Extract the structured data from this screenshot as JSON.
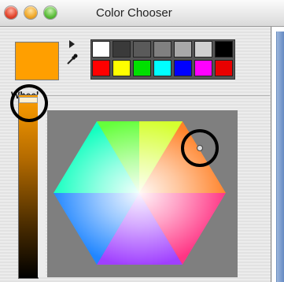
{
  "window": {
    "title": "Color Chooser"
  },
  "current_color": "#ff9f00",
  "palette": {
    "top_row": [
      "#ffffff",
      "#3a3a3a",
      "#5a5a5a",
      "#808080",
      "#a8a8a8",
      "#d0d0d0",
      "#000000"
    ],
    "bottom_row": [
      "#ff0000",
      "#ffff00",
      "#00e000",
      "#00ffff",
      "#0000ff",
      "#ff00ff",
      "#e80000"
    ]
  },
  "section": {
    "label": "Wheel"
  },
  "icons": {
    "disclosure": "disclosure-triangle-icon",
    "eyedropper": "eyedropper-icon"
  }
}
